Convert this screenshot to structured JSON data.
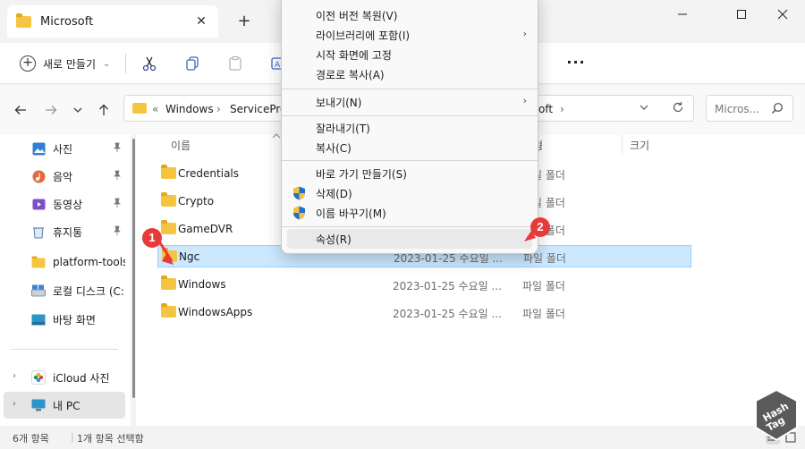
{
  "window": {
    "tab_title": "Microsoft",
    "tab_close": "✕",
    "new_tab": "+",
    "minimize": "─",
    "maximize": "☐",
    "close": "✕"
  },
  "toolbar": {
    "new_label": "새로 만들기",
    "new_chevron": "⌄",
    "more": "···"
  },
  "address": {
    "overflow": "«",
    "crumbs": [
      "Windows",
      "ServiceProf",
      "oft"
    ],
    "separator": "›",
    "search_placeholder": "Micros..."
  },
  "sidebar": {
    "items": [
      {
        "label": "사진",
        "icon": "pictures-icon",
        "pinned": true
      },
      {
        "label": "음악",
        "icon": "music-icon",
        "pinned": true
      },
      {
        "label": "동영상",
        "icon": "videos-icon",
        "pinned": true
      },
      {
        "label": "휴지통",
        "icon": "recycle-bin-icon",
        "pinned": true
      },
      {
        "label": "platform-tools",
        "icon": "folder-icon",
        "pinned": false
      },
      {
        "label": "로컬 디스크 (C:",
        "icon": "drive-icon",
        "pinned": false
      },
      {
        "label": "바탕 화면",
        "icon": "desktop-icon",
        "pinned": false
      },
      {
        "label": "iCloud 사진",
        "icon": "icloud-photos-icon",
        "pinned": false
      },
      {
        "label": "내 PC",
        "icon": "this-pc-icon",
        "pinned": false
      }
    ],
    "pin_glyph": "📌",
    "expand_glyph": "›"
  },
  "columns": {
    "name": "이름",
    "type": "형",
    "size": "크기"
  },
  "files": [
    {
      "name": "Credentials",
      "date": "",
      "type": "파일 폴더"
    },
    {
      "name": "Crypto",
      "date": "",
      "type": "파일 폴더"
    },
    {
      "name": "GameDVR",
      "date": "",
      "type": "파일 폴더"
    },
    {
      "name": "Ngc",
      "date": "2023-01-25 수요일 ...",
      "type": "파일 폴더"
    },
    {
      "name": "Windows",
      "date": "2023-01-25 수요일 ...",
      "type": "파일 폴더"
    },
    {
      "name": "WindowsApps",
      "date": "2023-01-25 수요일 ...",
      "type": "파일 폴더"
    }
  ],
  "context_menu": {
    "items": [
      {
        "label": "이전 버전 복원(V)",
        "arrow": ""
      },
      {
        "label": "라이브러리에 포함(I)",
        "arrow": "›"
      },
      {
        "label": "시작 화면에 고정",
        "arrow": ""
      },
      {
        "label": "경로로 복사(A)",
        "arrow": ""
      },
      {
        "label": "보내기(N)",
        "arrow": "›"
      },
      {
        "label": "잘라내기(T)",
        "arrow": ""
      },
      {
        "label": "복사(C)",
        "arrow": ""
      },
      {
        "label": "바로 가기 만들기(S)",
        "arrow": ""
      },
      {
        "label": "삭제(D)",
        "arrow": ""
      },
      {
        "label": "이름 바꾸기(M)",
        "arrow": ""
      },
      {
        "label": "속성(R)",
        "arrow": ""
      }
    ]
  },
  "badges": {
    "one": "1",
    "two": "2"
  },
  "status": {
    "item_count": "6개 항목",
    "selected": "1개 항목 선택함"
  },
  "watermark": {
    "text1": "Hash",
    "text2": "Tag"
  },
  "colors": {
    "folder": "#f5c542",
    "selection": "#cce8ff",
    "badge": "#e63b3b"
  }
}
